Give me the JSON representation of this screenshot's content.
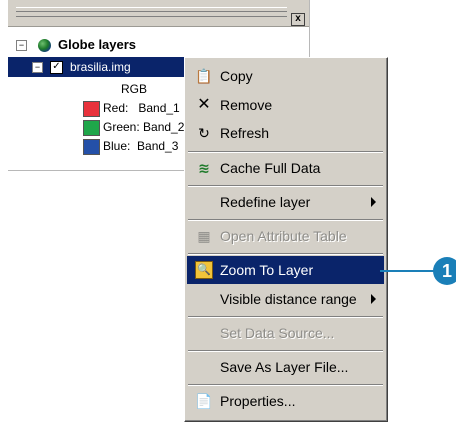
{
  "toc": {
    "close_glyph": "x",
    "root_label": "Globe layers",
    "root_expander": "−",
    "layer_expander": "−",
    "layer_label": "brasilia.img",
    "layer_checked": "✓",
    "rgb_label": "RGB",
    "bands": [
      {
        "label": "Red:   Band_1",
        "color": "#e8323c"
      },
      {
        "label": "Green: Band_2",
        "color": "#1fa64a"
      },
      {
        "label": "Blue:  Band_3",
        "color": "#2450a8"
      }
    ]
  },
  "menu": {
    "items": [
      {
        "icon": "📋",
        "text": "Copy"
      },
      {
        "icon": "✕",
        "text": "Remove"
      },
      {
        "icon": "↻",
        "text": "Refresh"
      },
      {
        "icon": "≋",
        "text": "Cache Full Data"
      },
      {
        "text": "Redefine layer"
      },
      {
        "icon": "▦",
        "text": "Open Attribute Table"
      },
      {
        "icon": "🔍",
        "text": "Zoom To Layer"
      },
      {
        "text": "Visible distance range"
      },
      {
        "text": "Set Data Source..."
      },
      {
        "text": "Save As Layer File..."
      },
      {
        "icon": "📄",
        "text": "Properties..."
      }
    ]
  },
  "callout": {
    "number": "1",
    "color": "#1a7fb8"
  }
}
